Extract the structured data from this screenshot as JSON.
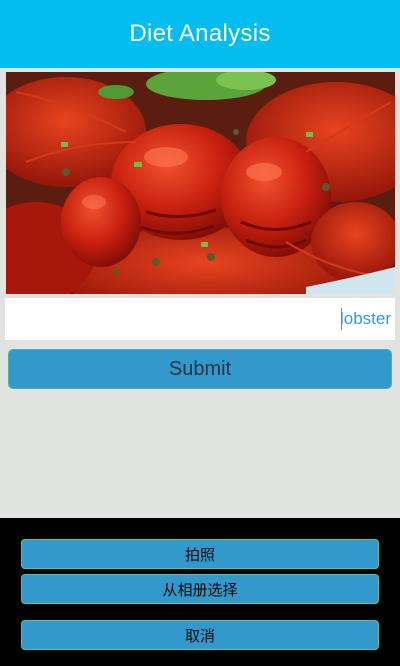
{
  "header": {
    "title": "Diet Analysis"
  },
  "photo": {
    "subject": "crayfish-dish-photo"
  },
  "food_input": {
    "value": "lobster",
    "placeholder": ""
  },
  "submit_label": "Submit",
  "action_sheet": {
    "take_photo_label": "拍照",
    "choose_album_label": "从相册选择",
    "cancel_label": "取消"
  },
  "colors": {
    "header": "#03bdf0",
    "button": "#3399cc",
    "background": "#e1e3e1",
    "sheet": "#000000"
  }
}
